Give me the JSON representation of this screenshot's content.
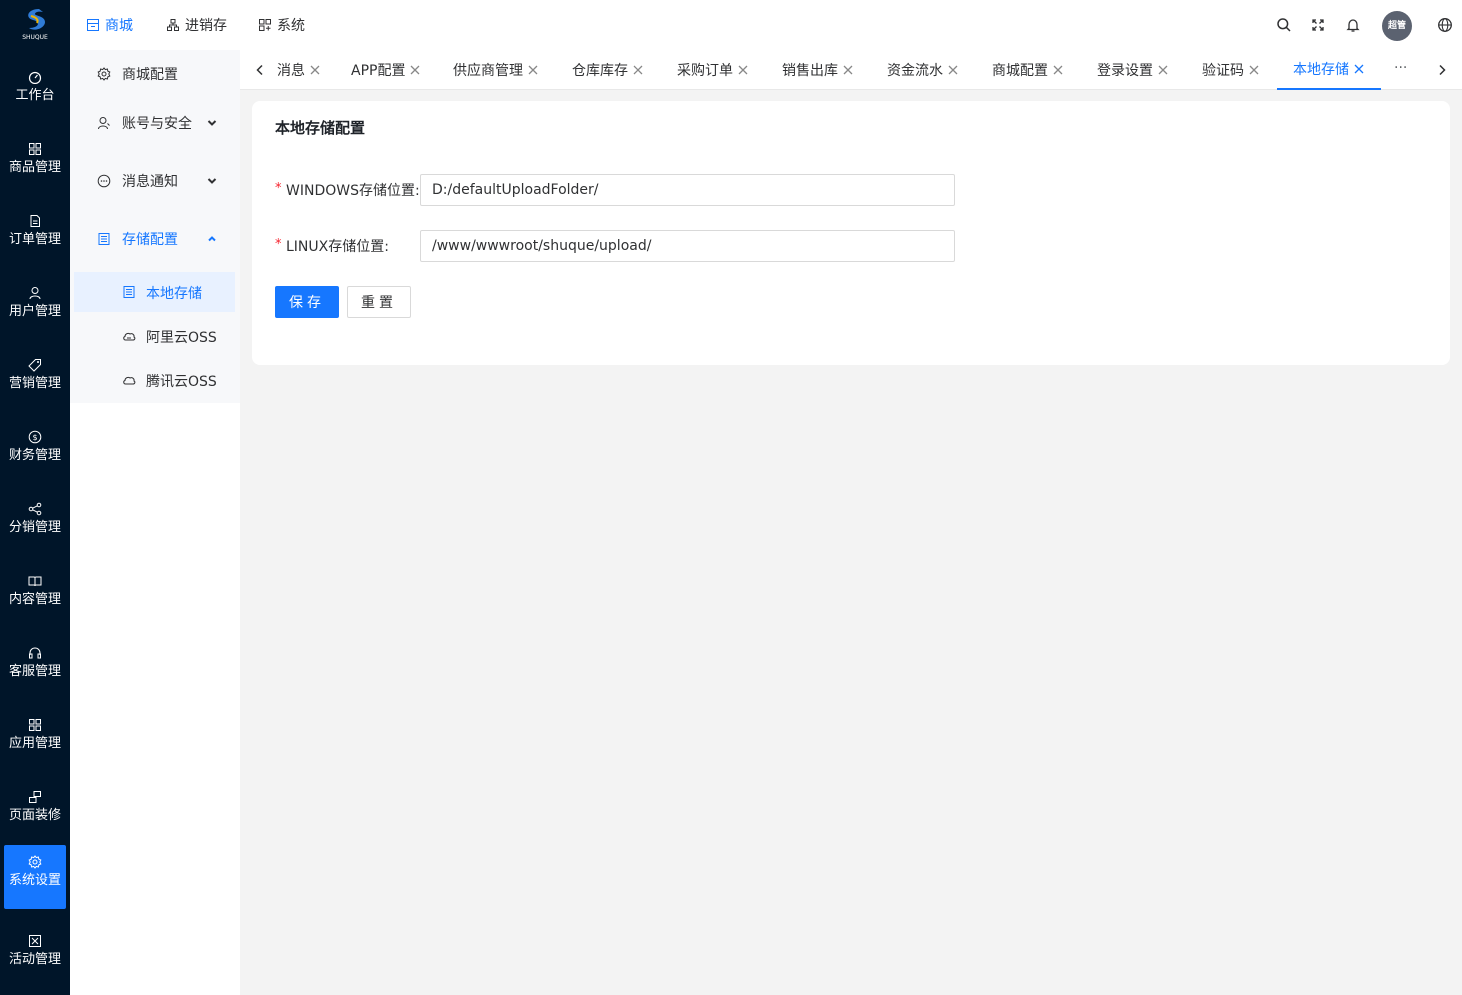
{
  "logo": {
    "text": "SHUQUE"
  },
  "rail": {
    "items": [
      {
        "label": "工作台",
        "icon": "dashboard-icon"
      },
      {
        "label": "商品管理",
        "icon": "grid-icon"
      },
      {
        "label": "订单管理",
        "icon": "file-icon"
      },
      {
        "label": "用户管理",
        "icon": "user-icon"
      },
      {
        "label": "营销管理",
        "icon": "tag-icon"
      },
      {
        "label": "财务管理",
        "icon": "money-icon"
      },
      {
        "label": "分销管理",
        "icon": "share-icon"
      },
      {
        "label": "内容管理",
        "icon": "book-icon"
      },
      {
        "label": "客服管理",
        "icon": "headset-icon"
      },
      {
        "label": "应用管理",
        "icon": "apps-icon"
      },
      {
        "label": "页面装修",
        "icon": "layout-icon"
      },
      {
        "label": "系统设置",
        "icon": "gear-icon",
        "active": true
      },
      {
        "label": "活动管理",
        "icon": "activity-icon"
      }
    ]
  },
  "topnav": {
    "items": [
      {
        "label": "商城",
        "icon": "shop-icon",
        "active": true
      },
      {
        "label": "进销存",
        "icon": "cluster-icon"
      },
      {
        "label": "系统",
        "icon": "system-icon"
      }
    ],
    "avatar_text": "超管"
  },
  "sidebar": {
    "menus": [
      {
        "label": "商城配置",
        "icon": "gear-icon"
      },
      {
        "label": "账号与安全",
        "icon": "user-icon",
        "expanded": false
      },
      {
        "label": "消息通知",
        "icon": "message-icon",
        "expanded": false
      },
      {
        "label": "存储配置",
        "icon": "storage-icon",
        "expanded": true
      }
    ],
    "subitems": [
      {
        "label": "本地存储",
        "icon": "storage-icon",
        "active": true
      },
      {
        "label": "阿里云OSS",
        "icon": "cloud-icon"
      },
      {
        "label": "腾讯云OSS",
        "icon": "cloud-icon"
      }
    ]
  },
  "tabs": {
    "items": [
      {
        "label": "消息"
      },
      {
        "label": "APP配置"
      },
      {
        "label": "供应商管理"
      },
      {
        "label": "仓库库存"
      },
      {
        "label": "采购订单"
      },
      {
        "label": "销售出库"
      },
      {
        "label": "资金流水"
      },
      {
        "label": "商城配置"
      },
      {
        "label": "登录设置"
      },
      {
        "label": "验证码"
      },
      {
        "label": "本地存储",
        "active": true
      }
    ],
    "more": "···"
  },
  "card": {
    "title": "本地存储配置",
    "fields": [
      {
        "label": "WINDOWS存储位置:",
        "value": "D:/defaultUploadFolder/",
        "required": true
      },
      {
        "label": "LINUX存储位置:",
        "value": "/www/wwwroot/shuque/upload/",
        "required": true
      }
    ],
    "save_label": "保存",
    "reset_label": "重置"
  },
  "colors": {
    "primary": "#1677ff",
    "rail_bg": "#001529",
    "required": "#f5222d"
  }
}
